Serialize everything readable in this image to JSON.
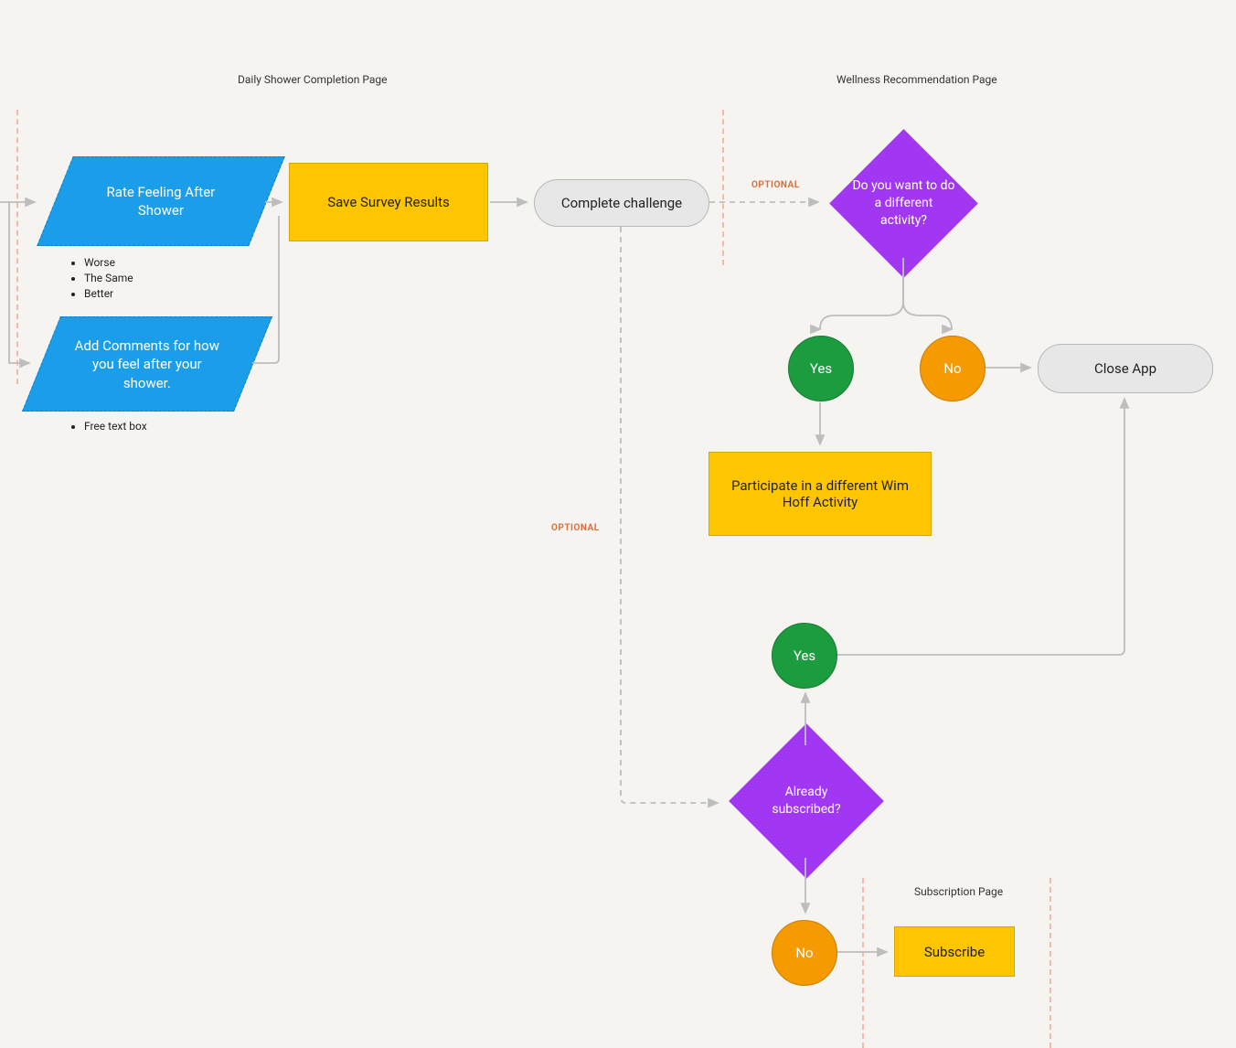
{
  "pages": {
    "dailyShower": "Daily Shower Completion Page",
    "wellness": "Wellness Recommendation Page",
    "subscription": "Subscription Page"
  },
  "labels": {
    "optional": "OPTIONAL"
  },
  "nodes": {
    "rateFeeling": "Rate Feeling After Shower",
    "rateOptions": [
      "Worse",
      "The Same",
      "Better"
    ],
    "addComments": "Add Comments for how you feel after your shower.",
    "commentOptions": [
      "Free text box"
    ],
    "saveSurvey": "Save Survey Results",
    "complete": "Complete challenge",
    "diffActivity": "Do you want to do a different activity?",
    "yes1": "Yes",
    "no1": "No",
    "closeApp": "Close App",
    "participate": "Participate in a different Wim Hoff Activity",
    "alreadySub": "Already subscribed?",
    "yes2": "Yes",
    "no2": "No",
    "subscribe": "Subscribe"
  }
}
